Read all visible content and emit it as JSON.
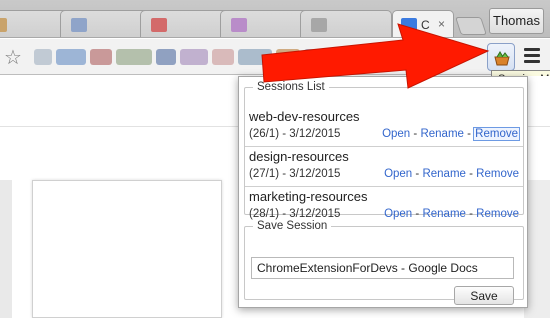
{
  "browser": {
    "profile_name": "Thomas",
    "active_tab_title": "C",
    "active_tab_close": "×",
    "tooltip": "Session Manager"
  },
  "popup": {
    "sessions_legend": "Sessions List",
    "sessions": [
      {
        "name": "web-dev-resources",
        "date": "(26/1) - 3/12/2015",
        "open": "Open",
        "rename": "Rename",
        "remove": "Remove"
      },
      {
        "name": "design-resources",
        "date": "(27/1) - 3/12/2015",
        "open": "Open",
        "rename": "Rename",
        "remove": "Remove"
      },
      {
        "name": "marketing-resources",
        "date": "(28/1) - 3/12/2015",
        "open": "Open",
        "rename": "Rename",
        "remove": "Remove"
      }
    ],
    "separator": "-",
    "save_legend": "Save Session",
    "save_input_value": "ChromeExtensionForDevs - Google Docs",
    "save_label": "Save"
  },
  "colors": {
    "link": "#3366cc",
    "arrow": "#ff1a00"
  }
}
